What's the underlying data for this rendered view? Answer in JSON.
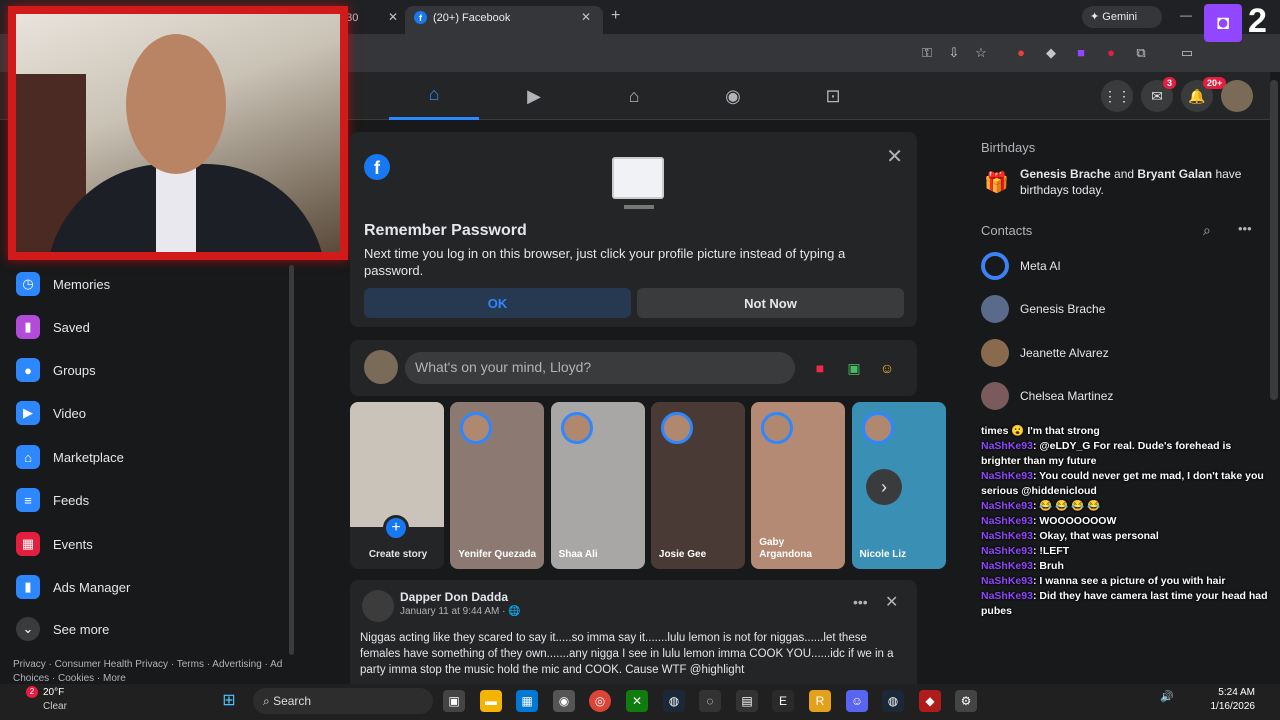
{
  "browser": {
    "tabs": [
      {
        "label": "930"
      },
      {
        "label": "(20+) Facebook"
      }
    ],
    "gemini_label": "Gemini"
  },
  "twitch_overlay": {
    "number": "2"
  },
  "nav": {
    "messenger_badge": "3",
    "notifications_badge": "20+"
  },
  "sidebar": {
    "items": [
      {
        "label": "Memories",
        "icon": "clock-icon",
        "color": "#2d88ff"
      },
      {
        "label": "Saved",
        "icon": "bookmark-icon",
        "color": "#b14bd8"
      },
      {
        "label": "Groups",
        "icon": "groups-icon",
        "color": "#2d88ff"
      },
      {
        "label": "Video",
        "icon": "video-icon",
        "color": "#2d88ff"
      },
      {
        "label": "Marketplace",
        "icon": "shop-icon",
        "color": "#2d88ff"
      },
      {
        "label": "Feeds",
        "icon": "feeds-icon",
        "color": "#2d88ff"
      },
      {
        "label": "Events",
        "icon": "calendar-icon",
        "color": "#e41e3f"
      },
      {
        "label": "Ads Manager",
        "icon": "chart-icon",
        "color": "#2d88ff"
      },
      {
        "label": "See more",
        "icon": "chevron-down-icon",
        "color": "#3a3b3c"
      }
    ],
    "footer": "Privacy · Consumer Health Privacy · Terms · Advertising · Ad Choices · Cookies · More"
  },
  "remember_password": {
    "title": "Remember Password",
    "body": "Next time you log in on this browser, just click your profile picture instead of typing a password.",
    "ok_label": "OK",
    "not_now_label": "Not Now"
  },
  "composer": {
    "placeholder": "What's on your mind, Lloyd?"
  },
  "stories": [
    {
      "name": "Create story",
      "color": "#d9d5cf"
    },
    {
      "name": "Yenifer Quezada",
      "color": "#8c7a72"
    },
    {
      "name": "Shaa Ali",
      "color": "#a8a7a5"
    },
    {
      "name": "Josie Gee",
      "color": "#4a3a36"
    },
    {
      "name": "Gaby Argandona",
      "color": "#b58a74"
    },
    {
      "name": "Nicole Liz",
      "color": "#3a8fb5"
    }
  ],
  "post": {
    "author": "Dapper Don Dadda",
    "date": "January 11 at 9:44 AM · ",
    "text": "Niggas acting like they scared to say it.....so imma say it.......lulu lemon is not for niggas......let these females have something of they own.......any nigga I see in lulu lemon imma COOK YOU......idc if we in a party imma stop the music hold the mic and COOK. Cause WTF @highlight"
  },
  "right": {
    "birthdays_title": "Birthdays",
    "birthday_name1": "Genesis Brache",
    "birthday_and": " and ",
    "birthday_name2": "Bryant Galan",
    "birthday_rest": " have birthdays today.",
    "contacts_title": "Contacts",
    "contacts": [
      {
        "name": "Meta AI"
      },
      {
        "name": "Genesis Brache"
      },
      {
        "name": "Jeanette Alvarez"
      },
      {
        "name": "Chelsea Martinez"
      }
    ]
  },
  "chat": [
    {
      "user": "",
      "msg": "times 😮 I'm that strong"
    },
    {
      "user": "NaShKe93",
      "msg": ": @eLDY_G For real. Dude's forehead is brighter than my future"
    },
    {
      "user": "NaShKe93",
      "msg": ": You could never get me mad, I don't take you serious @hiddenicloud"
    },
    {
      "user": "NaShKe93",
      "msg": ": 😂 😂 😂 😂"
    },
    {
      "user": "NaShKe93",
      "msg": ": WOOOOOOOW"
    },
    {
      "user": "NaShKe93",
      "msg": ": Okay, that was personal"
    },
    {
      "user": "NaShKe93",
      "msg": ": !LEFT"
    },
    {
      "user": "NaShKe93",
      "msg": ": Bruh"
    },
    {
      "user": "NaShKe93",
      "msg": ": I wanna see a picture of you with hair"
    },
    {
      "user": "NaShKe93",
      "msg": ": Did they have camera last time your head had pubes"
    }
  ],
  "taskbar": {
    "weather_temp": "20°F",
    "weather_cond": "Clear",
    "search_label": "Search",
    "time": "5:24 AM",
    "date": "1/16/2026"
  }
}
